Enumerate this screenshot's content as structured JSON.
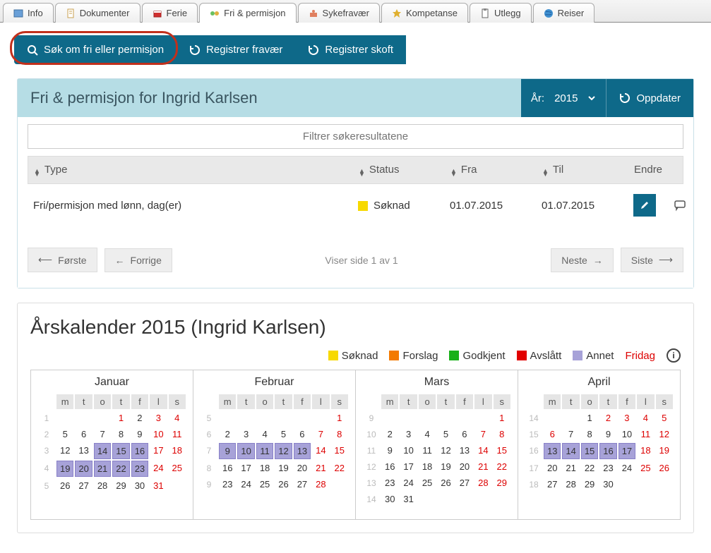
{
  "tabs": [
    {
      "label": "Info",
      "icon": "info"
    },
    {
      "label": "Dokumenter",
      "icon": "doc"
    },
    {
      "label": "Ferie",
      "icon": "ferie"
    },
    {
      "label": "Fri & permisjon",
      "icon": "fri"
    },
    {
      "label": "Sykefravær",
      "icon": "syk"
    },
    {
      "label": "Kompetanse",
      "icon": "star"
    },
    {
      "label": "Utlegg",
      "icon": "utlegg"
    },
    {
      "label": "Reiser",
      "icon": "globe"
    }
  ],
  "active_tab": 3,
  "toolbar": {
    "sok_label": "Søk om fri eller permisjon",
    "registrer_fravaer": "Registrer fravær",
    "registrer_skoft": "Registrer skoft"
  },
  "panel": {
    "title": "Fri & permisjon for Ingrid Karlsen",
    "year_label": "År:",
    "year_value": "2015",
    "update_label": "Oppdater",
    "filter_placeholder": "Filtrer søkeresultatene",
    "columns": {
      "type": "Type",
      "status": "Status",
      "fra": "Fra",
      "til": "Til",
      "endre": "Endre"
    },
    "rows": [
      {
        "type": "Fri/permisjon med lønn, dag(er)",
        "status": "Søknad",
        "status_color": "#f7d900",
        "fra": "01.07.2015",
        "til": "01.07.2015"
      }
    ],
    "pager": {
      "first": "Første",
      "prev": "Forrige",
      "info": "Viser side 1 av 1",
      "next": "Neste",
      "last": "Siste"
    }
  },
  "calendar": {
    "title": "Årskalender 2015 (Ingrid Karlsen)",
    "legend": [
      {
        "label": "Søknad",
        "color": "#f7d900"
      },
      {
        "label": "Forslag",
        "color": "#f37a00"
      },
      {
        "label": "Godkjent",
        "color": "#1ab01a"
      },
      {
        "label": "Avslått",
        "color": "#e10000"
      },
      {
        "label": "Annet",
        "color": "#a7a2d8"
      }
    ],
    "fridag_label": "Fridag",
    "dow": [
      "m",
      "t",
      "o",
      "t",
      "f",
      "l",
      "s"
    ],
    "months": [
      {
        "name": "Januar",
        "weeks": [
          {
            "wk": 1,
            "days": [
              {
                "n": "",
                "c": ""
              },
              {
                "n": "",
                "c": ""
              },
              {
                "n": "",
                "c": ""
              },
              {
                "n": "1",
                "c": "red"
              },
              {
                "n": "2",
                "c": ""
              },
              {
                "n": "3",
                "c": "red"
              },
              {
                "n": "4",
                "c": "red"
              }
            ]
          },
          {
            "wk": 2,
            "days": [
              {
                "n": "5",
                "c": ""
              },
              {
                "n": "6",
                "c": ""
              },
              {
                "n": "7",
                "c": ""
              },
              {
                "n": "8",
                "c": ""
              },
              {
                "n": "9",
                "c": ""
              },
              {
                "n": "10",
                "c": "red"
              },
              {
                "n": "11",
                "c": "red"
              }
            ]
          },
          {
            "wk": 3,
            "days": [
              {
                "n": "12",
                "c": ""
              },
              {
                "n": "13",
                "c": ""
              },
              {
                "n": "14",
                "c": "hl"
              },
              {
                "n": "15",
                "c": "hl"
              },
              {
                "n": "16",
                "c": "hl"
              },
              {
                "n": "17",
                "c": "red"
              },
              {
                "n": "18",
                "c": "red"
              }
            ]
          },
          {
            "wk": 4,
            "days": [
              {
                "n": "19",
                "c": "hl"
              },
              {
                "n": "20",
                "c": "hl"
              },
              {
                "n": "21",
                "c": "hl"
              },
              {
                "n": "22",
                "c": "hl"
              },
              {
                "n": "23",
                "c": "hl"
              },
              {
                "n": "24",
                "c": "red"
              },
              {
                "n": "25",
                "c": "red"
              }
            ]
          },
          {
            "wk": 5,
            "days": [
              {
                "n": "26",
                "c": ""
              },
              {
                "n": "27",
                "c": ""
              },
              {
                "n": "28",
                "c": ""
              },
              {
                "n": "29",
                "c": ""
              },
              {
                "n": "30",
                "c": ""
              },
              {
                "n": "31",
                "c": "red"
              },
              {
                "n": "",
                "c": ""
              }
            ]
          }
        ]
      },
      {
        "name": "Februar",
        "weeks": [
          {
            "wk": 5,
            "days": [
              {
                "n": "",
                "c": ""
              },
              {
                "n": "",
                "c": ""
              },
              {
                "n": "",
                "c": ""
              },
              {
                "n": "",
                "c": ""
              },
              {
                "n": "",
                "c": ""
              },
              {
                "n": "",
                "c": ""
              },
              {
                "n": "1",
                "c": "red"
              }
            ]
          },
          {
            "wk": 6,
            "days": [
              {
                "n": "2",
                "c": ""
              },
              {
                "n": "3",
                "c": ""
              },
              {
                "n": "4",
                "c": ""
              },
              {
                "n": "5",
                "c": ""
              },
              {
                "n": "6",
                "c": ""
              },
              {
                "n": "7",
                "c": "red"
              },
              {
                "n": "8",
                "c": "red"
              }
            ]
          },
          {
            "wk": 7,
            "days": [
              {
                "n": "9",
                "c": "hl"
              },
              {
                "n": "10",
                "c": "hl"
              },
              {
                "n": "11",
                "c": "hl"
              },
              {
                "n": "12",
                "c": "hl"
              },
              {
                "n": "13",
                "c": "hl"
              },
              {
                "n": "14",
                "c": "red"
              },
              {
                "n": "15",
                "c": "red"
              }
            ]
          },
          {
            "wk": 8,
            "days": [
              {
                "n": "16",
                "c": ""
              },
              {
                "n": "17",
                "c": ""
              },
              {
                "n": "18",
                "c": ""
              },
              {
                "n": "19",
                "c": ""
              },
              {
                "n": "20",
                "c": ""
              },
              {
                "n": "21",
                "c": "red"
              },
              {
                "n": "22",
                "c": "red"
              }
            ]
          },
          {
            "wk": 9,
            "days": [
              {
                "n": "23",
                "c": ""
              },
              {
                "n": "24",
                "c": ""
              },
              {
                "n": "25",
                "c": ""
              },
              {
                "n": "26",
                "c": ""
              },
              {
                "n": "27",
                "c": ""
              },
              {
                "n": "28",
                "c": "red"
              },
              {
                "n": "",
                "c": ""
              }
            ]
          }
        ]
      },
      {
        "name": "Mars",
        "weeks": [
          {
            "wk": 9,
            "days": [
              {
                "n": "",
                "c": ""
              },
              {
                "n": "",
                "c": ""
              },
              {
                "n": "",
                "c": ""
              },
              {
                "n": "",
                "c": ""
              },
              {
                "n": "",
                "c": ""
              },
              {
                "n": "",
                "c": ""
              },
              {
                "n": "1",
                "c": "red"
              }
            ]
          },
          {
            "wk": 10,
            "days": [
              {
                "n": "2",
                "c": ""
              },
              {
                "n": "3",
                "c": ""
              },
              {
                "n": "4",
                "c": ""
              },
              {
                "n": "5",
                "c": ""
              },
              {
                "n": "6",
                "c": ""
              },
              {
                "n": "7",
                "c": "red"
              },
              {
                "n": "8",
                "c": "red"
              }
            ]
          },
          {
            "wk": 11,
            "days": [
              {
                "n": "9",
                "c": ""
              },
              {
                "n": "10",
                "c": ""
              },
              {
                "n": "11",
                "c": ""
              },
              {
                "n": "12",
                "c": ""
              },
              {
                "n": "13",
                "c": ""
              },
              {
                "n": "14",
                "c": "red"
              },
              {
                "n": "15",
                "c": "red"
              }
            ]
          },
          {
            "wk": 12,
            "days": [
              {
                "n": "16",
                "c": ""
              },
              {
                "n": "17",
                "c": ""
              },
              {
                "n": "18",
                "c": ""
              },
              {
                "n": "19",
                "c": ""
              },
              {
                "n": "20",
                "c": ""
              },
              {
                "n": "21",
                "c": "red"
              },
              {
                "n": "22",
                "c": "red"
              }
            ]
          },
          {
            "wk": 13,
            "days": [
              {
                "n": "23",
                "c": ""
              },
              {
                "n": "24",
                "c": ""
              },
              {
                "n": "25",
                "c": ""
              },
              {
                "n": "26",
                "c": ""
              },
              {
                "n": "27",
                "c": ""
              },
              {
                "n": "28",
                "c": "red"
              },
              {
                "n": "29",
                "c": "red"
              }
            ]
          },
          {
            "wk": 14,
            "days": [
              {
                "n": "30",
                "c": ""
              },
              {
                "n": "31",
                "c": ""
              },
              {
                "n": "",
                "c": ""
              },
              {
                "n": "",
                "c": ""
              },
              {
                "n": "",
                "c": ""
              },
              {
                "n": "",
                "c": ""
              },
              {
                "n": "",
                "c": ""
              }
            ]
          }
        ]
      },
      {
        "name": "April",
        "weeks": [
          {
            "wk": 14,
            "days": [
              {
                "n": "",
                "c": ""
              },
              {
                "n": "",
                "c": ""
              },
              {
                "n": "1",
                "c": ""
              },
              {
                "n": "2",
                "c": "red"
              },
              {
                "n": "3",
                "c": "red"
              },
              {
                "n": "4",
                "c": "red"
              },
              {
                "n": "5",
                "c": "red"
              }
            ]
          },
          {
            "wk": 15,
            "days": [
              {
                "n": "6",
                "c": "red"
              },
              {
                "n": "7",
                "c": ""
              },
              {
                "n": "8",
                "c": ""
              },
              {
                "n": "9",
                "c": ""
              },
              {
                "n": "10",
                "c": ""
              },
              {
                "n": "11",
                "c": "red"
              },
              {
                "n": "12",
                "c": "red"
              }
            ]
          },
          {
            "wk": 16,
            "days": [
              {
                "n": "13",
                "c": "hl"
              },
              {
                "n": "14",
                "c": "hl"
              },
              {
                "n": "15",
                "c": "hl"
              },
              {
                "n": "16",
                "c": "hl"
              },
              {
                "n": "17",
                "c": "hl"
              },
              {
                "n": "18",
                "c": "red"
              },
              {
                "n": "19",
                "c": "red"
              }
            ]
          },
          {
            "wk": 17,
            "days": [
              {
                "n": "20",
                "c": ""
              },
              {
                "n": "21",
                "c": ""
              },
              {
                "n": "22",
                "c": ""
              },
              {
                "n": "23",
                "c": ""
              },
              {
                "n": "24",
                "c": ""
              },
              {
                "n": "25",
                "c": "red"
              },
              {
                "n": "26",
                "c": "red"
              }
            ]
          },
          {
            "wk": 18,
            "days": [
              {
                "n": "27",
                "c": ""
              },
              {
                "n": "28",
                "c": ""
              },
              {
                "n": "29",
                "c": ""
              },
              {
                "n": "30",
                "c": ""
              },
              {
                "n": "",
                "c": ""
              },
              {
                "n": "",
                "c": ""
              },
              {
                "n": "",
                "c": ""
              }
            ]
          }
        ]
      }
    ]
  }
}
